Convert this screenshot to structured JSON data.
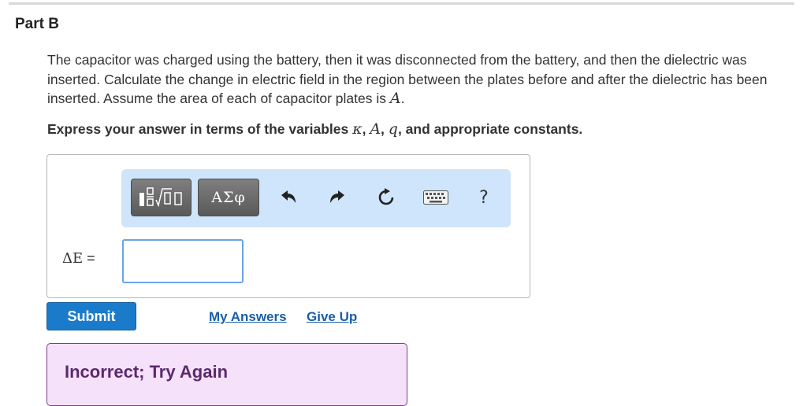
{
  "part_title": "Part B",
  "question": {
    "text_before_var": "The capacitor was charged using the battery, then it was disconnected from the battery, and then the dielectric was inserted. Calculate the change in electric field in the region between the plates before and after the dielectric has been inserted. Assume the area of each of capacitor plates is ",
    "var": "A",
    "text_after_var": "."
  },
  "instruction": {
    "prefix": "Express your answer in terms of the variables ",
    "var1": "κ",
    "sep1": ", ",
    "var2": "A",
    "sep2": ", ",
    "var3": "q",
    "suffix": ", and appropriate constants."
  },
  "toolbar": {
    "symbols_label": "ΑΣφ",
    "help_label": "?",
    "icons": [
      "templates-icon",
      "undo-icon",
      "redo-icon",
      "reset-icon",
      "keyboard-icon",
      "help-icon"
    ]
  },
  "equation": {
    "symbol": "ΔE",
    "equals": " =",
    "input_value": ""
  },
  "actions": {
    "submit_label": "Submit",
    "my_answers_label": "My Answers",
    "give_up_label": "Give Up"
  },
  "feedback": {
    "text": "Incorrect; Try Again"
  },
  "colors": {
    "toolbar_bg": "#cfe5fb",
    "submit_bg": "#1b7bcb",
    "link": "#1a5fa8",
    "feedback_bg": "#f6e1fa",
    "feedback_border": "#7a3f8c",
    "input_border": "#6aa3e6"
  }
}
